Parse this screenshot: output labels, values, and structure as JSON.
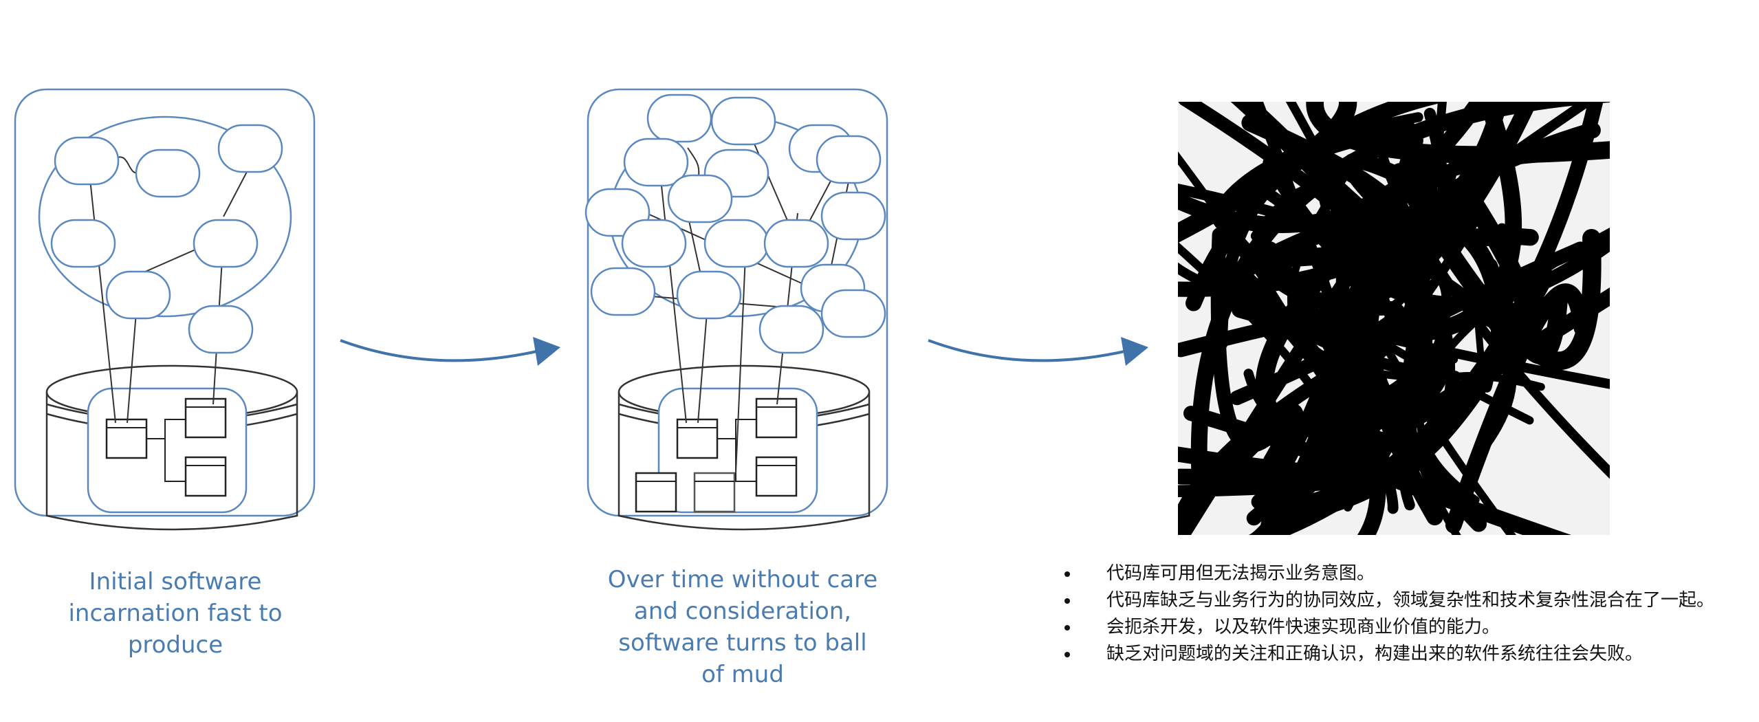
{
  "captions": {
    "initial": "Initial software\nincarnation fast to\nproduce",
    "later": "Over time without care\nand consideration,\nsoftware turns to ball\nof mud"
  },
  "bullets": [
    "代码库可用但无法揭示业务意图。",
    "代码库缺乏与业务行为的协同效应，领域复杂性和技术复杂性混合在了一起。",
    "会扼杀开发，以及软件快速实现商业价值的能力。",
    "缺乏对问题域的关注和正确认识，构建出来的软件系统往往会失败。"
  ],
  "colors": {
    "accent": "#3f73aa",
    "caption": "#4a7cb0",
    "line": "#222222"
  }
}
